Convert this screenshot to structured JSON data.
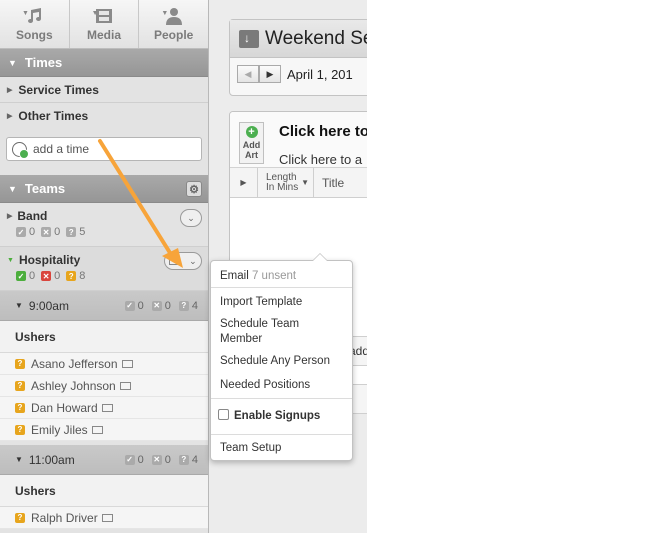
{
  "tabs": [
    {
      "label": "Songs",
      "icon": "music-note-icon"
    },
    {
      "label": "Media",
      "icon": "film-icon"
    },
    {
      "label": "People",
      "icon": "person-icon"
    }
  ],
  "times": {
    "header": "Times",
    "items": [
      "Service Times",
      "Other Times"
    ],
    "add_placeholder": "add a time"
  },
  "teams": {
    "header": "Teams",
    "band": {
      "name": "Band",
      "confirmed": "0",
      "declined": "0",
      "unconfirmed": "5"
    },
    "hospitality": {
      "name": "Hospitality",
      "confirmed": "0",
      "declined": "0",
      "unconfirmed": "8"
    }
  },
  "slots": [
    {
      "time": "9:00am",
      "confirmed": "0",
      "declined": "0",
      "unconfirmed": "4",
      "position": "Ushers",
      "people": [
        "Asano Jefferson",
        "Ashley Johnson",
        "Dan Howard",
        "Emily Jiles"
      ]
    },
    {
      "time": "11:00am",
      "confirmed": "0",
      "declined": "0",
      "unconfirmed": "4",
      "position": "Ushers",
      "people": [
        "Ralph Driver"
      ]
    }
  ],
  "plan": {
    "title": "Weekend Se",
    "date": "April 1, 201",
    "add_art": "Add Art",
    "click_title": "Click here to",
    "click_sub": "Click here to a",
    "col_length": "Length In Mins",
    "col_title": "Title",
    "add_frag": "add"
  },
  "menu": {
    "email": "Email",
    "email_sub": "7 unsent",
    "import": "Import Template",
    "schedule_team": "Schedule Team Member",
    "schedule_any": "Schedule Any Person",
    "needed": "Needed Positions",
    "signups": "Enable Signups",
    "setup": "Team Setup"
  },
  "colors": {
    "accent_arrow": "#f7a43a",
    "confirmed": "#4cae3d",
    "declined": "#d9453d",
    "unconfirmed": "#e7a51d"
  }
}
